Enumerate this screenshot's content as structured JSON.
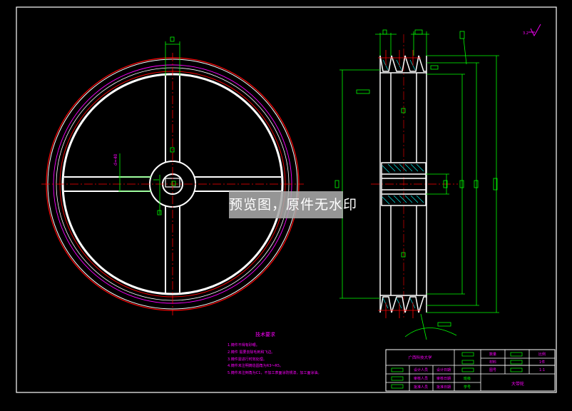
{
  "colors": {
    "background": "#000000",
    "outline": "#ffffff",
    "dimension": "#00ff00",
    "center": "#ff0000",
    "annotation": "#ff00ff",
    "hatch": "#00ffff"
  },
  "watermark": {
    "text": "预览图，原件无水印"
  },
  "front_view": {
    "dim_note": "d=40"
  },
  "side_view": {
    "roughness_note": "3.2"
  },
  "tech_requirements": {
    "title": "技术要求",
    "items": [
      "1.铸件不得有砂眼。",
      "2.铸件  需要去除毛刺和飞边。",
      "3.铸件需进行时效处理。",
      "4.铸件未注明铸造圆角为R3～R5。",
      "5.铸件未注倒角为C1，不加工表面涂防锈漆，加工面涂油。"
    ]
  },
  "title_block": {
    "unit_header": "广西科技大学",
    "material_label": "材料",
    "ratio_label": "比例",
    "ratio_value": "1:1",
    "quantity_label": "数量",
    "qty_value": "1件",
    "sheet_label": "图号",
    "part_name": "大带轮",
    "designer_label": "设计人员",
    "checker_label": "审核人员",
    "approver_label": "批准人员",
    "date_label": "日期",
    "design_date_label": "设计日期",
    "review_date_label": "审核日期",
    "approve_date_label": "批准日期",
    "class_label": "班级",
    "id_label": "学号"
  }
}
